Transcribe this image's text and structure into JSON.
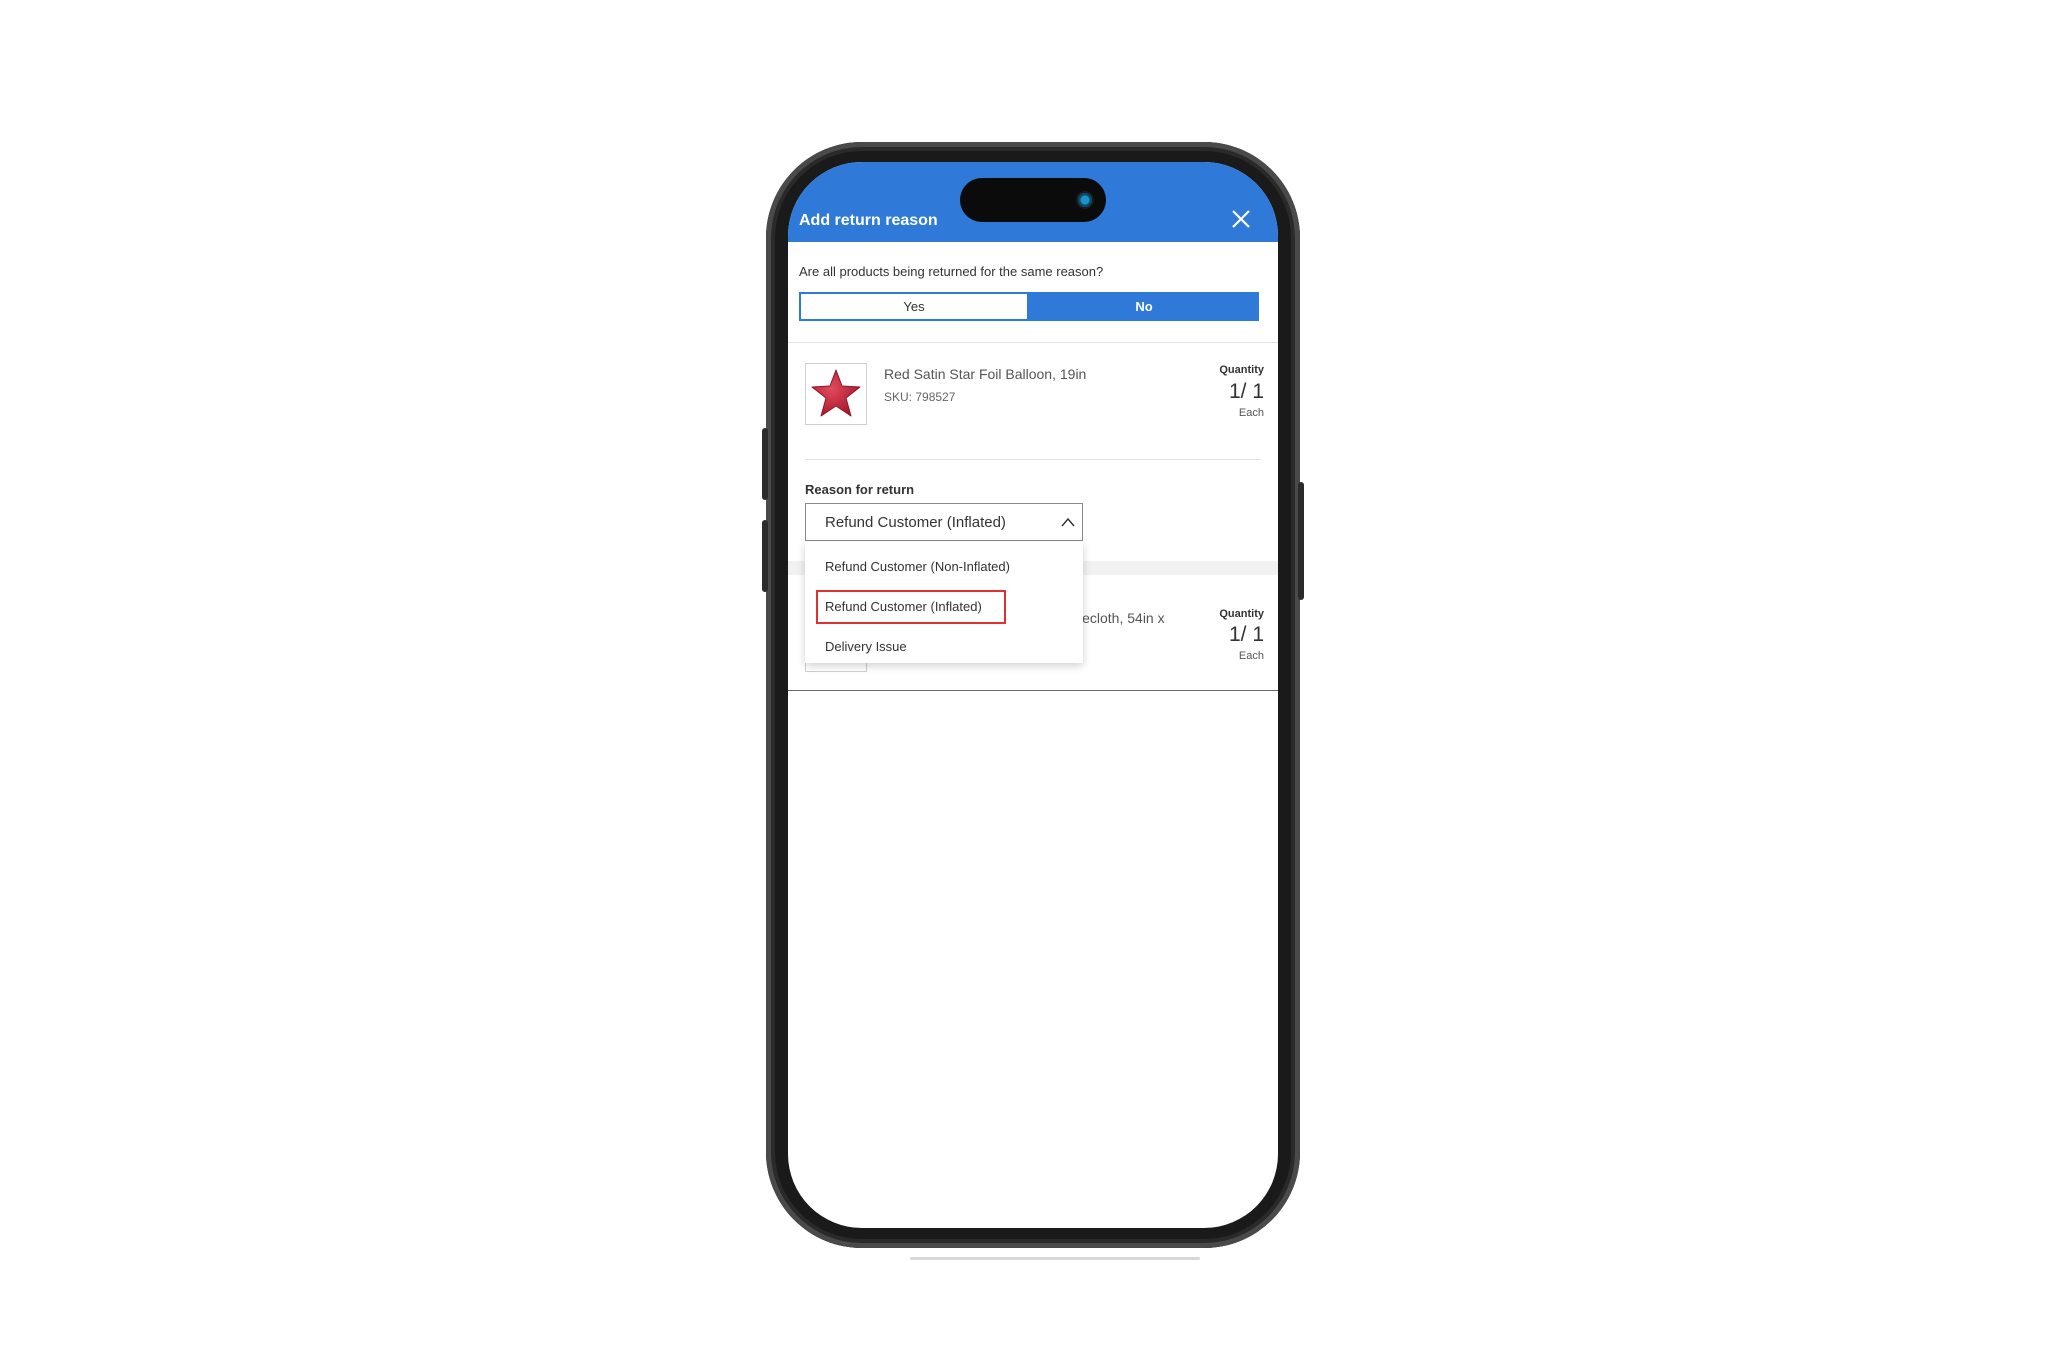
{
  "modal": {
    "title": "Add return reason"
  },
  "same_reason": {
    "question": "Are all products being returned for the same reason?",
    "yes_label": "Yes",
    "no_label": "No",
    "selected": "No"
  },
  "products": [
    {
      "name": "Red Satin Star Foil Balloon, 19in",
      "sku": "SKU: 798527",
      "quantity_label": "Quantity",
      "quantity": "1/ 1",
      "unit": "Each"
    },
    {
      "name": "lecloth, 54in x",
      "quantity_label": "Quantity",
      "quantity": "1/ 1",
      "unit": "Each"
    }
  ],
  "reason": {
    "label": "Reason for return",
    "selected_value": "Refund Customer (Inflated)",
    "options": [
      "Refund Customer (Non-Inflated)",
      "Refund Customer (Inflated)",
      "Delivery Issue"
    ]
  },
  "colors": {
    "accent": "#2f7ad9",
    "highlight": "#e0302f",
    "balloon": "#c8283c"
  },
  "icons": {
    "close": "close-icon",
    "chevron": "chevron-up-icon",
    "product": "star-balloon-icon"
  }
}
